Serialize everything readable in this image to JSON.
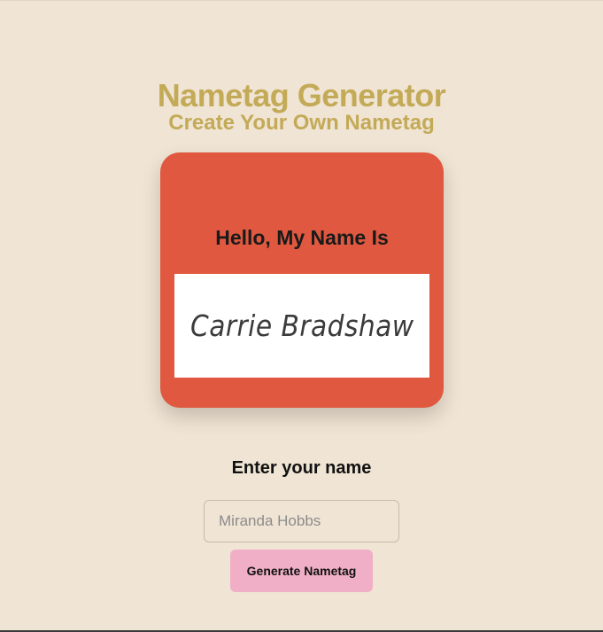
{
  "header": {
    "title": "Nametag Generator",
    "subtitle": "Create Your Own Nametag"
  },
  "nametag": {
    "greeting": "Hello, My Name Is",
    "name": "Carrie Bradshaw"
  },
  "form": {
    "label": "Enter your name",
    "input_value": "",
    "input_placeholder": "Miranda Hobbs",
    "button_label": "Generate Nametag"
  },
  "colors": {
    "background": "#f0e4d4",
    "title": "#c3aa57",
    "nametag": "#df583f",
    "button": "#f0afc6"
  }
}
